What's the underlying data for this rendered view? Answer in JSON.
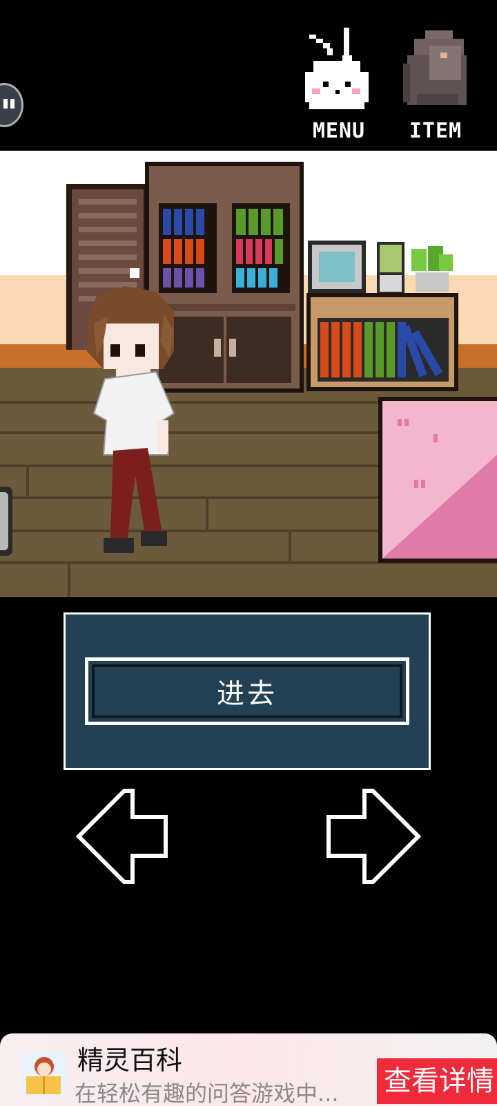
{
  "hud": {
    "menu_label": "MENU",
    "item_label": "ITEM",
    "menu_icon": "rabbit-icon",
    "item_icon": "backpack-icon"
  },
  "scene": {
    "name": "bedroom",
    "colors": {
      "wall": "#ffffff",
      "floor": "#6b5a3c",
      "bed": "#f4b6cd"
    }
  },
  "dialog": {
    "choice_label": "进去",
    "panel_color": "#234055"
  },
  "navigation": {
    "left_icon": "arrow-left-icon",
    "right_icon": "arrow-right-icon"
  },
  "ad": {
    "title": "精灵百科",
    "description": "在轻松有趣的问答游戏中...",
    "cta_label": "查看详情",
    "cta_color": "#ef2b3b"
  }
}
